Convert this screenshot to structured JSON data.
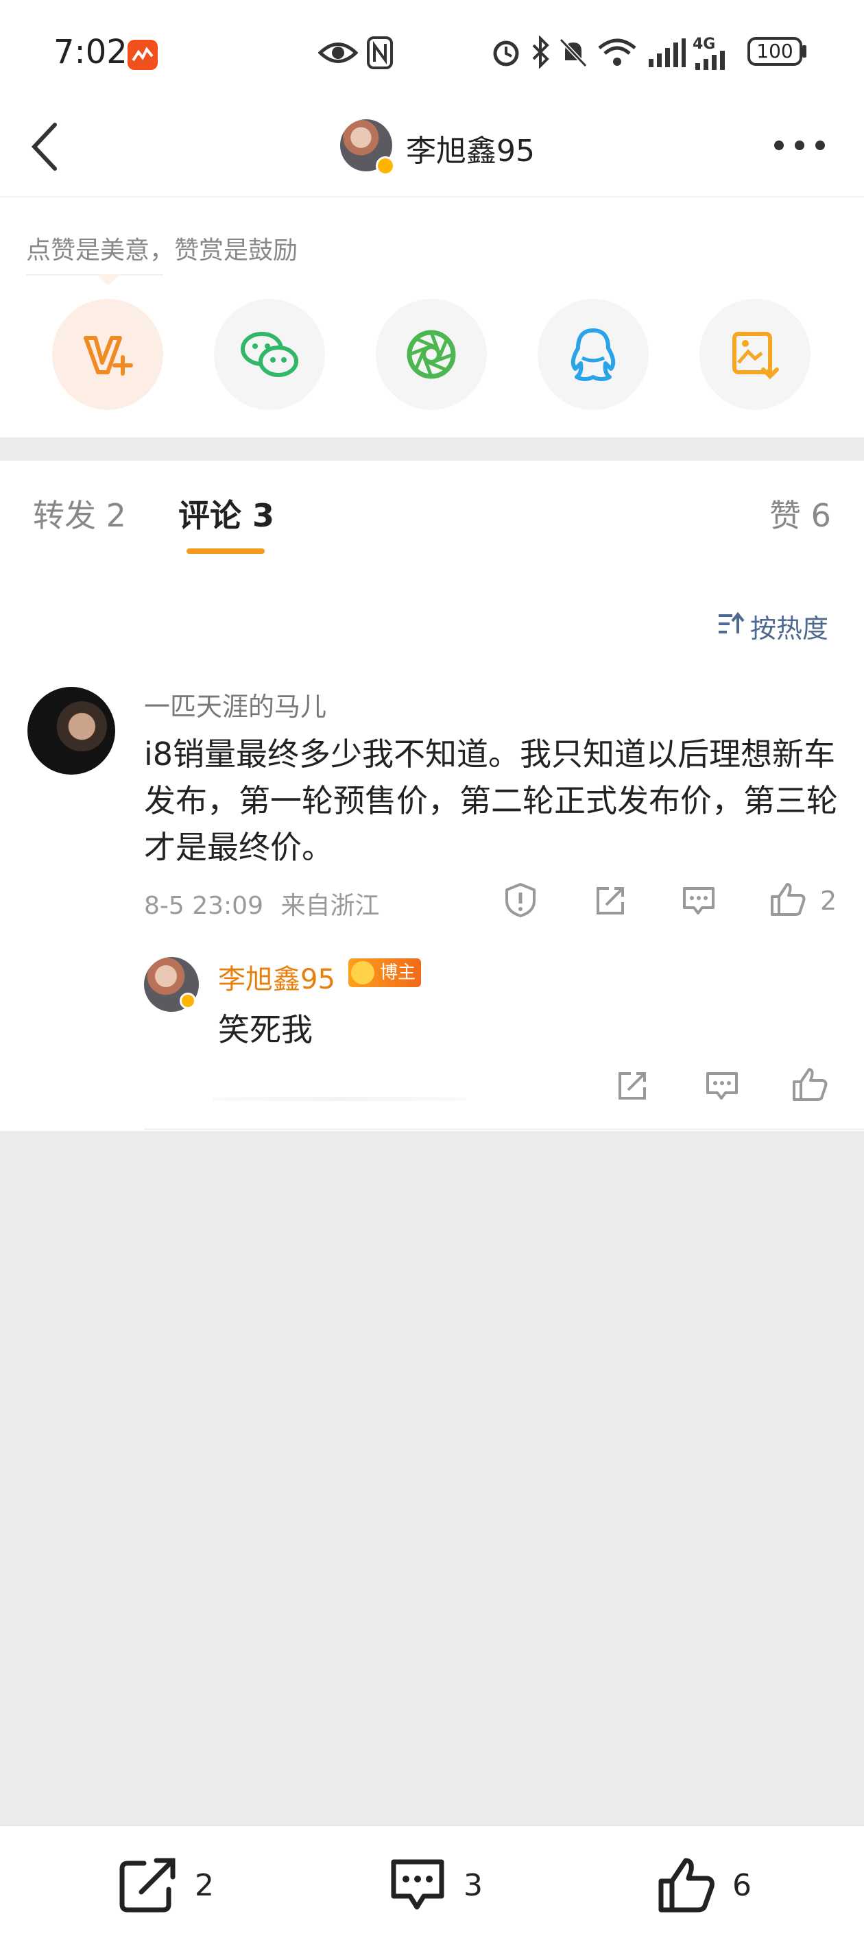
{
  "status_bar": {
    "time": "7:02",
    "battery": "100",
    "network": "4G"
  },
  "header": {
    "title": "李旭鑫95"
  },
  "reward": {
    "tip": "点赞是美意，赞赏是鼓励",
    "buttons": [
      "v-plus-reward-icon",
      "wechat-icon",
      "moments-icon",
      "qq-icon",
      "save-image-icon"
    ]
  },
  "tabs": {
    "repost": "转发 2",
    "comment": "评论 3",
    "like": "赞 6"
  },
  "sort": {
    "label": "按热度"
  },
  "comment": {
    "user": "一匹天涯的马儿",
    "text": "i8销量最终多少我不知道。我只知道以后理想新车发布，第一轮预售价，第二轮正式发布价，第三轮才是最终价。",
    "time": "8-5 23:09",
    "location": "来自浙江",
    "likes": "2",
    "reply": {
      "user": "李旭鑫95",
      "badge": "博主",
      "text": "笑死我"
    }
  },
  "bottom_bar": {
    "repost_count": "2",
    "comment_count": "3",
    "like_count": "6"
  },
  "colors": {
    "accent": "#f39a1c",
    "author": "#e8800f",
    "link": "#4e6991"
  }
}
